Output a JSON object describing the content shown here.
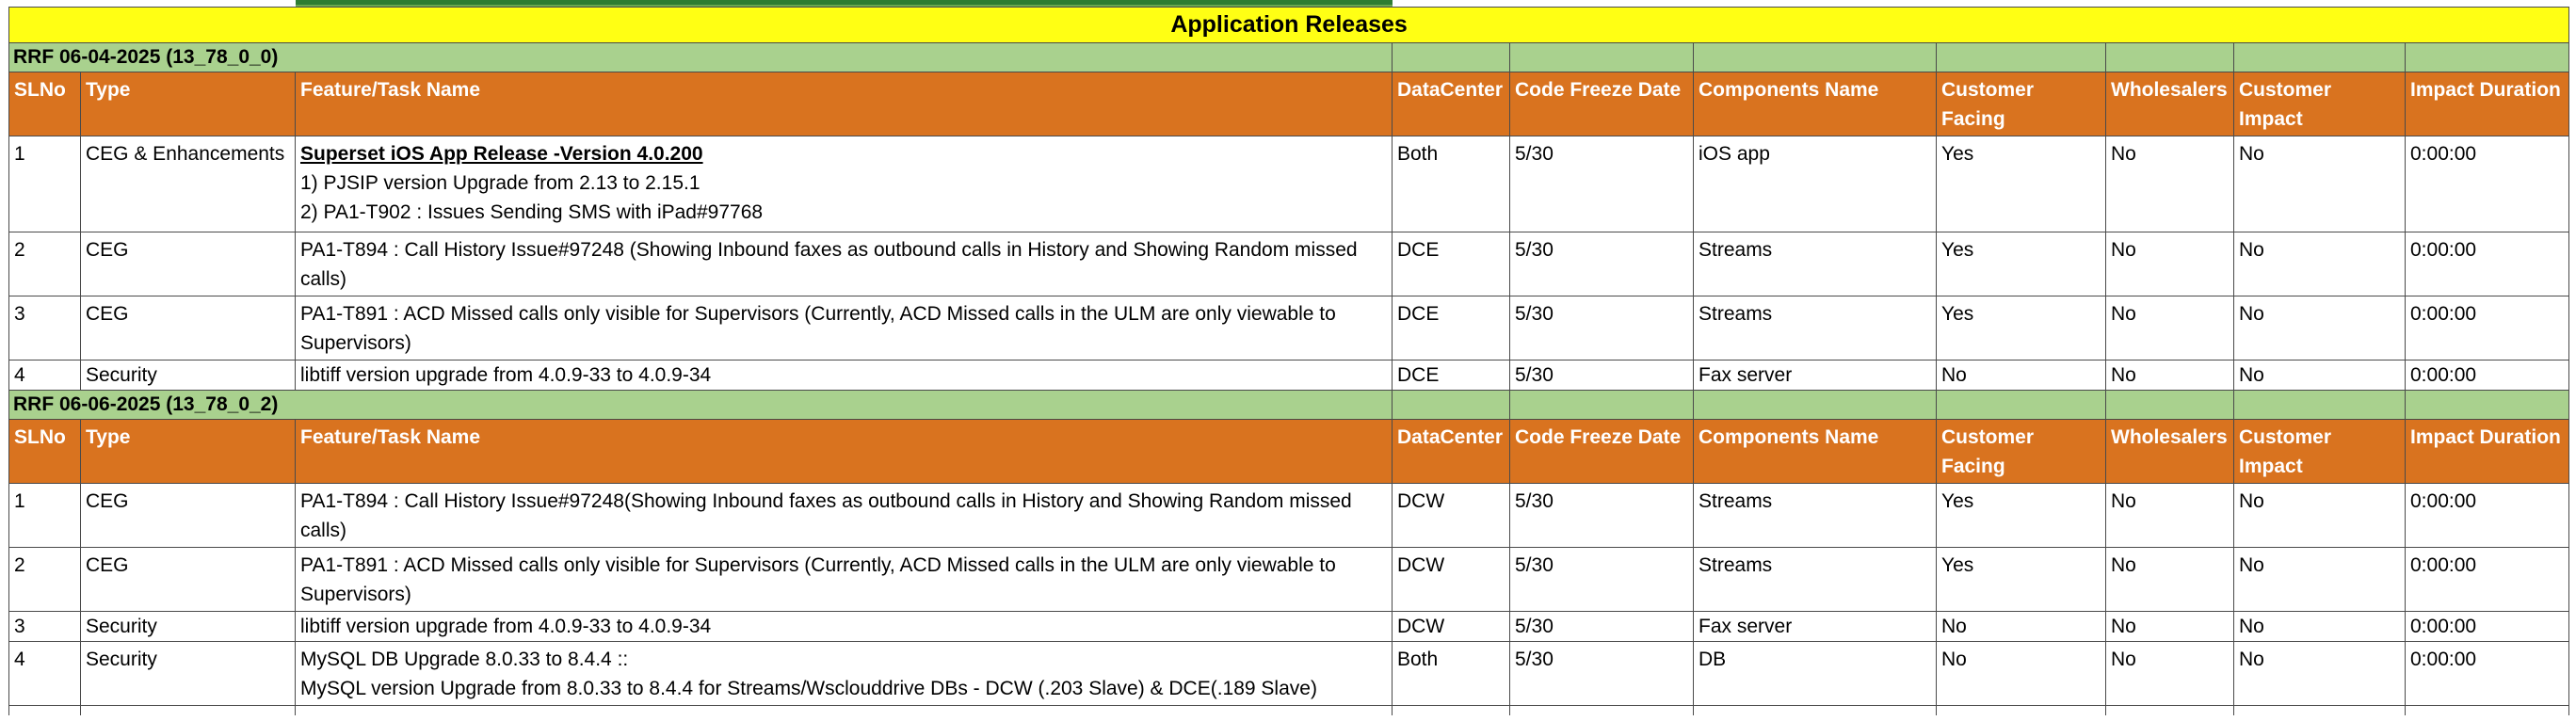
{
  "title": "Application Releases",
  "columns": [
    "SLNo",
    "Type",
    "Feature/Task Name",
    "DataCenter",
    "Code Freeze  Date",
    "Components Name",
    "Customer Facing",
    "Wholesalers",
    "Customer Impact",
    "Impact Duration"
  ],
  "releases": [
    {
      "label": "RRF 06-04-2025 (13_78_0_0)",
      "rows": [
        {
          "slno": "1",
          "type": "CEG & Enhancements",
          "feature_title": "Superset iOS App Release -Version 4.0.200 ",
          "feature_lines": [
            "1) PJSIP version Upgrade from 2.13 to 2.15.1",
            "2) PA1-T902 : Issues Sending SMS with iPad#97768"
          ],
          "datacenter": "Both",
          "code_freeze": "5/30",
          "component": "iOS app",
          "customer_facing": "Yes",
          "wholesalers": "No",
          "customer_impact": "No",
          "impact_duration": "0:00:00"
        },
        {
          "slno": "2",
          "type": "CEG",
          "feature_title": "",
          "feature_lines": [
            "PA1-T894 : Call History Issue#97248 (Showing Inbound faxes as outbound calls in History and Showing Random missed calls)"
          ],
          "datacenter": "DCE",
          "code_freeze": "5/30",
          "component": "Streams",
          "customer_facing": "Yes",
          "wholesalers": "No",
          "customer_impact": "No",
          "impact_duration": "0:00:00"
        },
        {
          "slno": "3",
          "type": "CEG",
          "feature_title": "",
          "feature_lines": [
            "PA1-T891 : ACD Missed calls only visible for Supervisors (Currently, ACD Missed calls in the ULM are only viewable to Supervisors)"
          ],
          "datacenter": "DCE",
          "code_freeze": "5/30",
          "component": "Streams",
          "customer_facing": "Yes",
          "wholesalers": "No",
          "customer_impact": "No",
          "impact_duration": "0:00:00"
        },
        {
          "slno": "4",
          "type": "Security",
          "feature_title": "",
          "feature_lines": [
            "libtiff version upgrade from 4.0.9-33 to 4.0.9-34"
          ],
          "datacenter": "DCE",
          "code_freeze": "5/30",
          "component": "Fax server",
          "customer_facing": "No",
          "wholesalers": "No",
          "customer_impact": "No",
          "impact_duration": "0:00:00"
        }
      ]
    },
    {
      "label": "RRF 06-06-2025 (13_78_0_2)",
      "rows": [
        {
          "slno": "1",
          "type": "CEG",
          "feature_title": "",
          "feature_lines": [
            "PA1-T894 : Call History Issue#97248(Showing Inbound faxes as outbound calls in History and Showing Random missed calls)"
          ],
          "datacenter": "DCW",
          "code_freeze": "5/30",
          "component": "Streams",
          "customer_facing": "Yes",
          "wholesalers": "No",
          "customer_impact": "No",
          "impact_duration": "0:00:00"
        },
        {
          "slno": "2",
          "type": "CEG",
          "feature_title": "",
          "feature_lines": [
            "PA1-T891 : ACD Missed calls only visible for Supervisors (Currently, ACD Missed calls in the ULM are only viewable to Supervisors)"
          ],
          "datacenter": "DCW",
          "code_freeze": "5/30",
          "component": "Streams",
          "customer_facing": "Yes",
          "wholesalers": "No",
          "customer_impact": "No",
          "impact_duration": "0:00:00"
        },
        {
          "slno": "3",
          "type": "Security",
          "feature_title": "",
          "feature_lines": [
            "libtiff version upgrade from 4.0.9-33 to 4.0.9-34"
          ],
          "datacenter": "DCW",
          "code_freeze": "5/30",
          "component": "Fax server",
          "customer_facing": "No",
          "wholesalers": "No",
          "customer_impact": "No",
          "impact_duration": "0:00:00"
        },
        {
          "slno": "4",
          "type": "Security",
          "feature_title": "",
          "feature_lines": [
            "MySQL DB Upgrade 8.0.33 to 8.4.4 ::",
            "MySQL version Upgrade from 8.0.33 to 8.4.4 for Streams/Wsclouddrive DBs - DCW (.203 Slave) & DCE(.189 Slave)"
          ],
          "datacenter": "Both",
          "code_freeze": "5/30",
          "component": "DB",
          "customer_facing": "No",
          "wholesalers": "No",
          "customer_impact": "No",
          "impact_duration": "0:00:00"
        }
      ]
    }
  ],
  "colors": {
    "title_bg": "#ffff14",
    "release_bg": "#a9d18e",
    "header_bg": "#d9731f",
    "header_text": "#ffffff"
  }
}
